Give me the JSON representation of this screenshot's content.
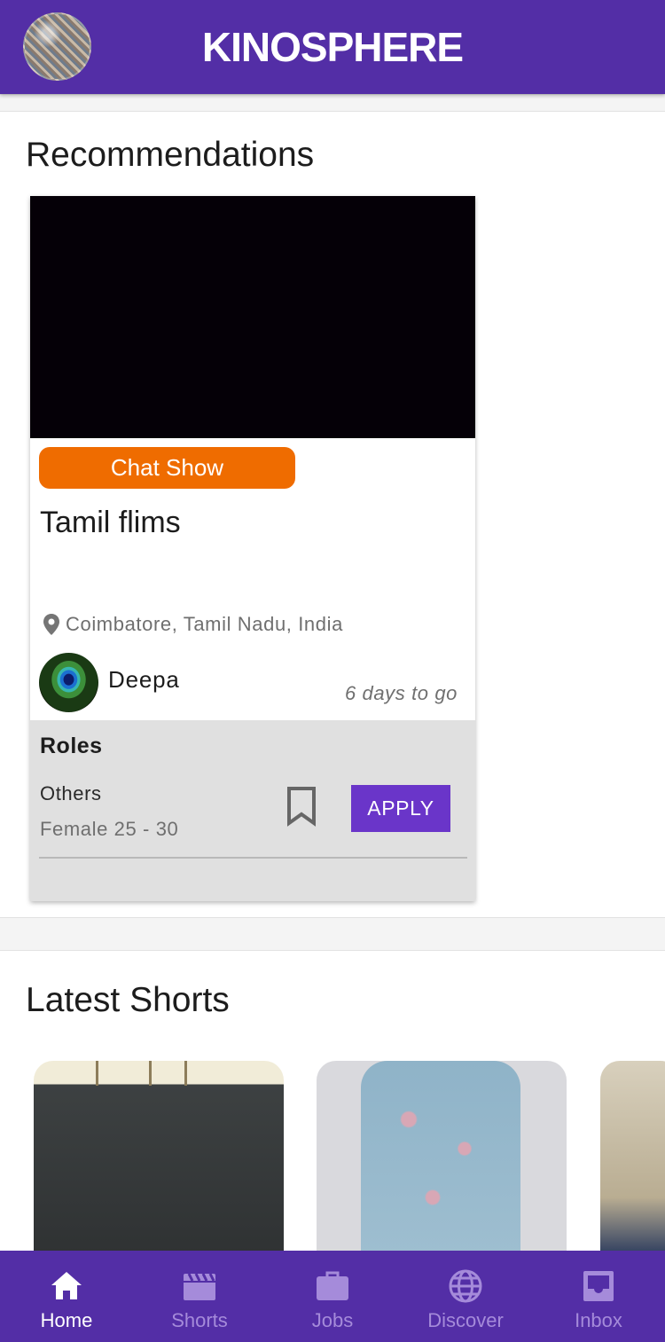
{
  "header": {
    "brand": "KINOSPHERE",
    "avatar_icon": "profile-avatar"
  },
  "recommendations": {
    "title": "Recommendations",
    "card": {
      "genre_tag": "Chat Show",
      "title": "Tamil flims",
      "location": "Coimbatore, Tamil Nadu, India",
      "location_icon": "location-pin-icon",
      "poster_name": "Deepa",
      "deadline": "6 days to go",
      "roles": {
        "heading": "Roles",
        "items": [
          {
            "name": "Others",
            "meta": "Female 25 - 30"
          }
        ]
      },
      "bookmark_icon": "bookmark-icon",
      "apply_label": "APPLY"
    }
  },
  "shorts": {
    "title": "Latest Shorts"
  },
  "bottom_nav": {
    "items": [
      {
        "label": "Home",
        "icon": "home-icon",
        "active": true
      },
      {
        "label": "Shorts",
        "icon": "clapperboard-icon",
        "active": false
      },
      {
        "label": "Jobs",
        "icon": "briefcase-icon",
        "active": false
      },
      {
        "label": "Discover",
        "icon": "globe-icon",
        "active": false
      },
      {
        "label": "Inbox",
        "icon": "inbox-icon",
        "active": false
      }
    ]
  },
  "colors": {
    "primary": "#532ea6",
    "accent_orange": "#ef6c00",
    "apply_button": "#6a35c9",
    "nav_inactive": "#a58bda"
  }
}
